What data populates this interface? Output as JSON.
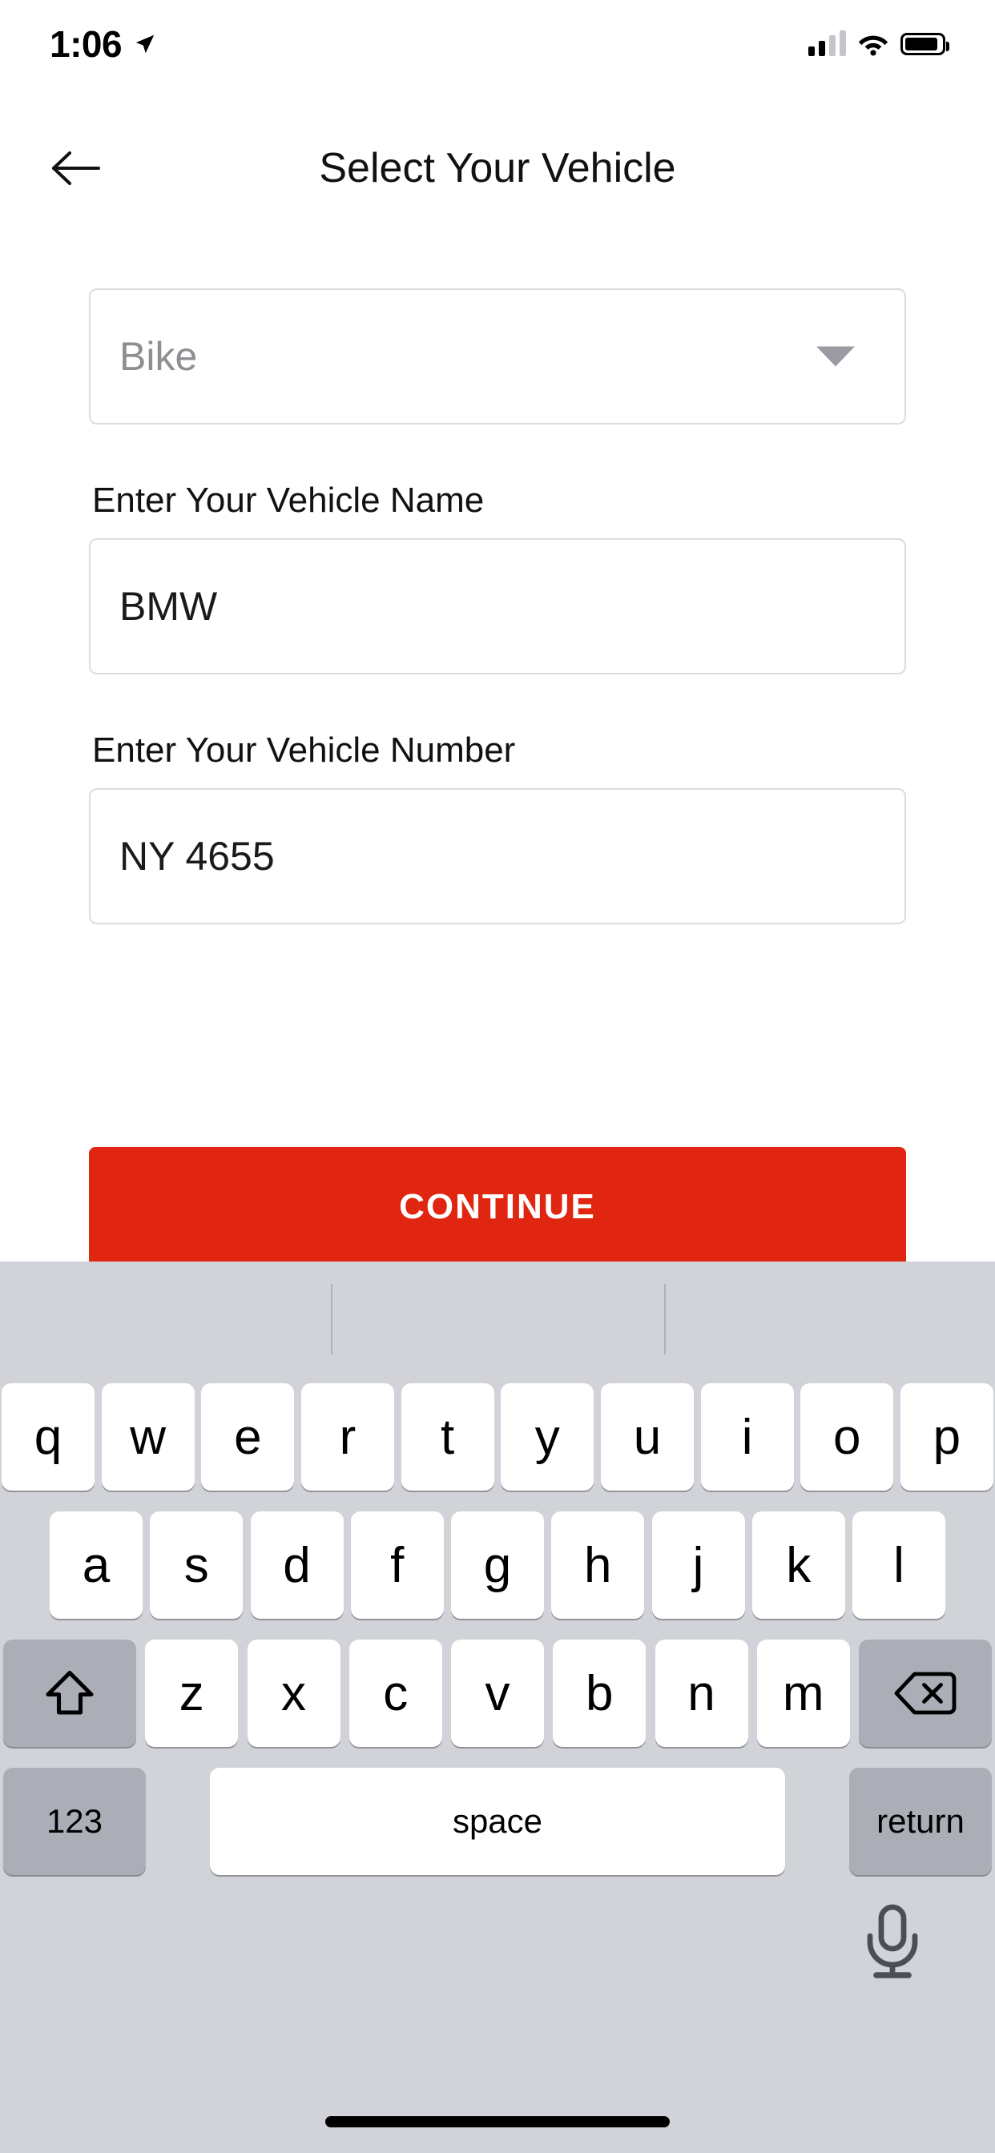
{
  "status_bar": {
    "time": "1:06",
    "location_icon": "location-arrow-icon",
    "signal_icon": "cellular-signal-icon",
    "wifi_icon": "wifi-icon",
    "battery_icon": "battery-icon"
  },
  "header": {
    "back_icon": "back-arrow-icon",
    "title": "Select Your Vehicle"
  },
  "form": {
    "vehicle_type": {
      "label": "",
      "value": "Bike",
      "is_placeholder": true,
      "caret_icon": "chevron-down-icon"
    },
    "vehicle_name": {
      "label": "Enter Your Vehicle Name",
      "value": "BMW"
    },
    "vehicle_number": {
      "label": "Enter Your Vehicle Number",
      "value": "NY 4655"
    }
  },
  "actions": {
    "continue_label": "CONTINUE",
    "continue_color": "#e02610"
  },
  "keyboard": {
    "row1": [
      "q",
      "w",
      "e",
      "r",
      "t",
      "y",
      "u",
      "i",
      "o",
      "p"
    ],
    "row2": [
      "a",
      "s",
      "d",
      "f",
      "g",
      "h",
      "j",
      "k",
      "l"
    ],
    "row3": [
      "z",
      "x",
      "c",
      "v",
      "b",
      "n",
      "m"
    ],
    "shift_icon": "shift-arrow-icon",
    "backspace_icon": "backspace-icon",
    "numeric_label": "123",
    "space_label": "space",
    "return_label": "return",
    "mic_icon": "microphone-icon",
    "predictions": []
  },
  "system": {
    "home_indicator": "home-indicator-bar"
  }
}
